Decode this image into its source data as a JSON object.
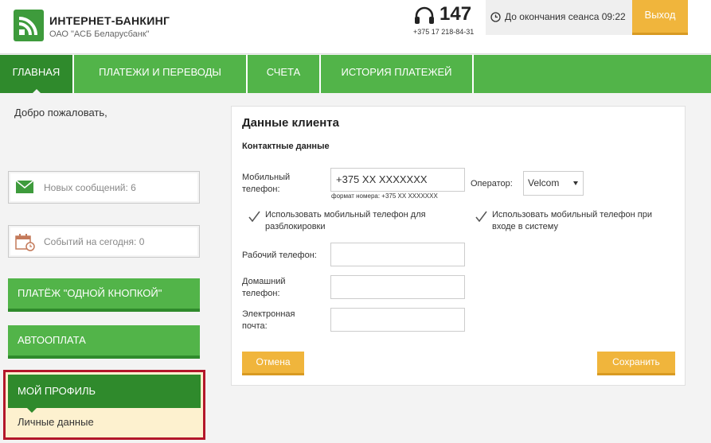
{
  "header": {
    "brand_title": "ИНТЕРНЕТ-БАНКИНГ",
    "brand_sub": "ОАО \"АСБ Беларусбанк\"",
    "phone_short": "147",
    "phone_full": "+375 17 218-84-31",
    "session_text": "До окончания сеанса 09:22",
    "logout_label": "Выход"
  },
  "nav": {
    "items": [
      {
        "label": "ГЛАВНАЯ",
        "active": true
      },
      {
        "label": "ПЛАТЕЖИ И ПЕРЕВОДЫ",
        "active": false
      },
      {
        "label": "СЧЕТА",
        "active": false
      },
      {
        "label": "ИСТОРИЯ ПЛАТЕЖЕЙ",
        "active": false
      }
    ]
  },
  "sidebar": {
    "welcome": "Добро пожаловать,",
    "messages": "Новых сообщений: 6",
    "events": "Событий на сегодня: 0",
    "one_click": "ПЛАТЁЖ \"ОДНОЙ КНОПКОЙ\"",
    "autopay": "АВТООПЛАТА",
    "profile_title": "МОЙ ПРОФИЛЬ",
    "profile_item": "Личные данные"
  },
  "form": {
    "title": "Данные клиента",
    "subtitle": "Контактные данные",
    "mobile_label_1": "Мобильный",
    "mobile_label_2": "телефон:",
    "mobile_value": "+375 XX XXXXXXX",
    "mobile_hint": "формат номера: +375 XX XXXXXXX",
    "operator_label": "Оператор:",
    "operator_value": "Velcom",
    "check1_line1": "Использовать мобильный телефон для",
    "check1_line2": "разблокировки",
    "check2_line1": "Использовать мобильный телефон при",
    "check2_line2": "входе в систему",
    "work_label": "Рабочий телефон:",
    "home_label_1": "Домашний",
    "home_label_2": "телефон:",
    "email_label_1": "Электронная",
    "email_label_2": "почта:",
    "cancel_label": "Отмена",
    "save_label": "Сохранить"
  },
  "colors": {
    "green": "#52b449",
    "dark_green": "#2f8a2c",
    "orange": "#f0b53c",
    "highlight_red": "#b3172a"
  }
}
